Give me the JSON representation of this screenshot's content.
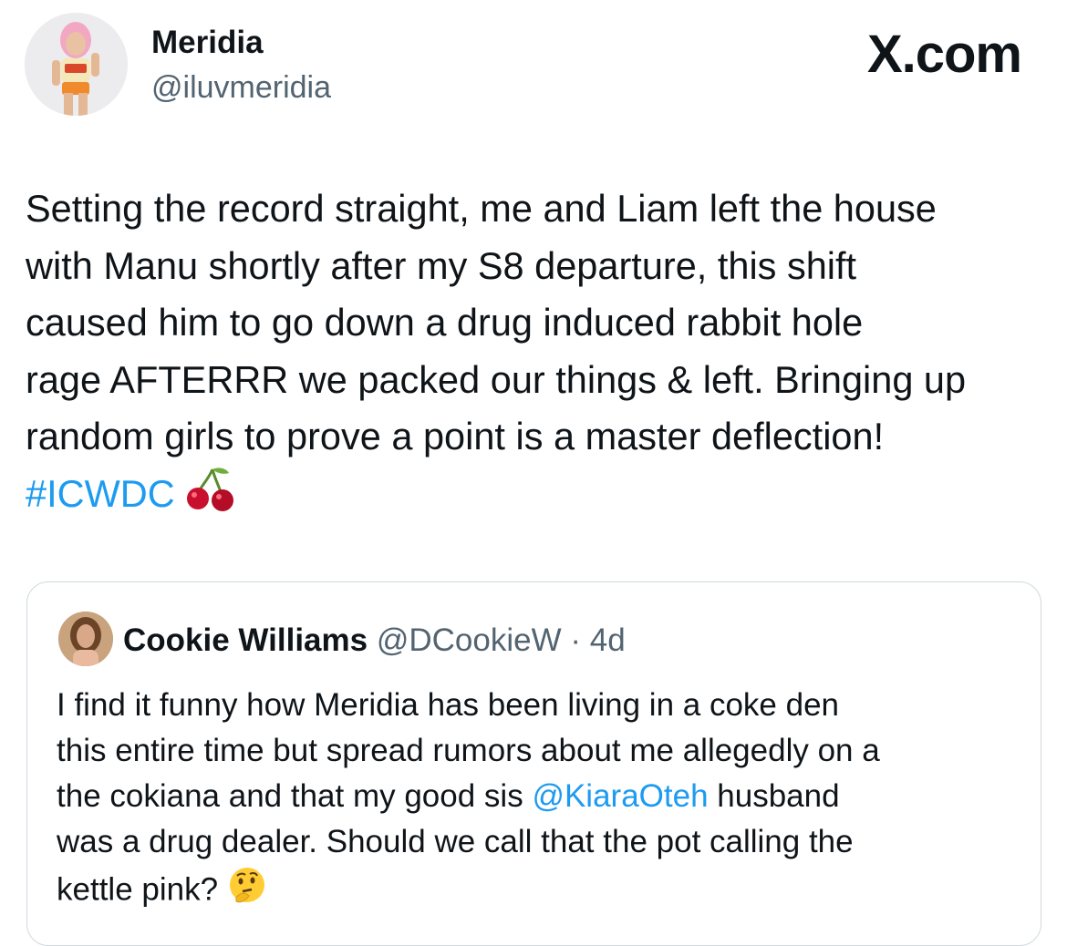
{
  "tweet": {
    "author_name": "Meridia",
    "author_handle": "@iluvmeridia",
    "brand": "X.com",
    "text_lines": [
      "Setting the record straight, me and Liam left the house",
      "with Manu shortly after my S8 departure, this shift",
      "caused him to go down a drug induced rabbit hole",
      "rage AFTERRR we packed our things & left. Bringing up",
      "random girls to prove a point is a master deflection!"
    ],
    "hashtag": "#ICWDC",
    "hashtag_emoji": "cherries-emoji"
  },
  "quoted_tweet": {
    "author_name": "Cookie Williams",
    "author_handle": "@DCookieW",
    "separator": "·",
    "age": "4d",
    "line1": "I find it funny how Meridia has been living in a coke den",
    "line2": "this entire time but spread rumors about me allegedly on a",
    "line3_pre": "the cokiana and that my good sis ",
    "line3_mention": "@KiaraOteh",
    "line3_post": " husband",
    "line4": "was a drug dealer. Should we call that the pot calling the",
    "line5": "kettle pink?",
    "end_emoji": "thinking-face-emoji"
  },
  "colors": {
    "text": "#0f1419",
    "secondary": "#536471",
    "link": "#1d9bf0",
    "border": "#cfd9de"
  }
}
